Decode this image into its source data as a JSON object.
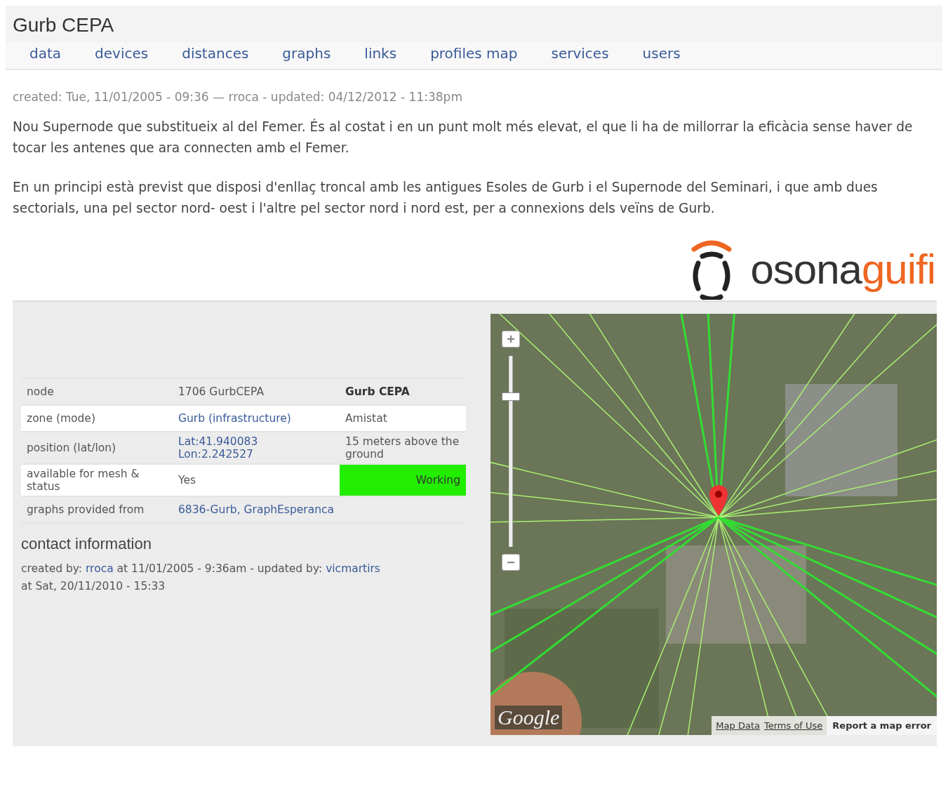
{
  "page": {
    "title": "Gurb CEPA"
  },
  "tabs": [
    {
      "label": "data"
    },
    {
      "label": "devices"
    },
    {
      "label": "distances"
    },
    {
      "label": "graphs"
    },
    {
      "label": "links"
    },
    {
      "label": "profiles map"
    },
    {
      "label": "services"
    },
    {
      "label": "users"
    }
  ],
  "meta": "created: Tue, 11/01/2005 - 09:36 — rroca - updated: 04/12/2012 - 11:38pm",
  "paragraphs": [
    "Nou Supernode que substitueix al del Femer. És al costat i en un punt molt més elevat, el que li ha de millorrar la eficàcia sense haver de tocar les antenes que ara connecten amb el Femer.",
    "En un principi està previst que disposi d'enllaç troncal amb les antigues Esoles de Gurb i el Supernode del Seminari, i que amb dues sectorials, una pel sector nord- oest i l'altre pel sector nord i nord est, per a connexions dels veïns de Gurb."
  ],
  "logo": {
    "dark": "osona",
    "accent": "guifi"
  },
  "table": {
    "rows": [
      {
        "label": "node",
        "cells": [
          {
            "kind": "plain",
            "text": "1706 GurbCEPA"
          },
          {
            "kind": "bold",
            "text": "Gurb CEPA"
          }
        ]
      },
      {
        "label": "zone (mode)",
        "cells": [
          {
            "kind": "link",
            "text": "Gurb (infrastructure)"
          },
          {
            "kind": "plain",
            "text": "Amistat"
          }
        ]
      },
      {
        "label": "position (lat/lon)",
        "cells": [
          {
            "kind": "link",
            "text": "Lat:41.940083 Lon:2.242527"
          },
          {
            "kind": "plain",
            "text": "15 meters above the ground"
          }
        ]
      },
      {
        "label": "available for mesh & status",
        "cells": [
          {
            "kind": "plain",
            "text": "Yes"
          },
          {
            "kind": "status",
            "text": "Working",
            "color": "#22ee00"
          }
        ]
      },
      {
        "label": "graphs provided from",
        "cells": [
          {
            "kind": "link",
            "text": "6836-Gurb, GraphEsperanca"
          }
        ]
      }
    ]
  },
  "contact": {
    "heading": "contact information",
    "parts": [
      {
        "kind": "text",
        "text": "created by: "
      },
      {
        "kind": "link",
        "text": "rroca"
      },
      {
        "kind": "text",
        "text": " at 11/01/2005 - 9:36am - updated by: "
      },
      {
        "kind": "link",
        "text": "vicmartirs"
      },
      {
        "kind": "text",
        "text": " at Sat, 20/11/2010 - 15:33"
      }
    ]
  },
  "map": {
    "zoom_in": "+",
    "zoom_out": "−",
    "zoom": {
      "level": 0.8
    },
    "logo": "Google",
    "links": [
      "Map Data",
      "Terms of Use"
    ],
    "report": "Report a map error"
  }
}
